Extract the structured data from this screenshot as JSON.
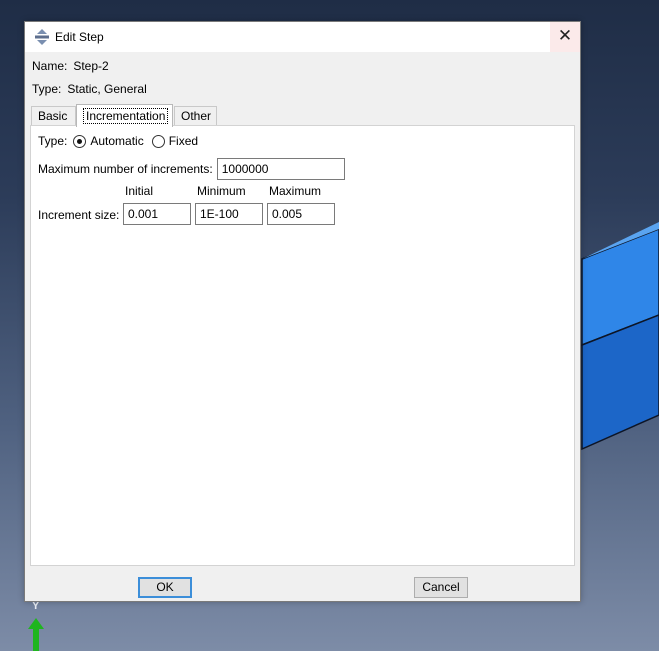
{
  "dialog": {
    "title": "Edit Step",
    "close_label": "✕",
    "name_label": "Name:",
    "name_value": "Step-2",
    "type_label": "Type:",
    "type_value": "Static, General"
  },
  "tabs": [
    {
      "label": "Basic",
      "active": false
    },
    {
      "label": "Incrementation",
      "active": true
    },
    {
      "label": "Other",
      "active": false
    }
  ],
  "incrementation": {
    "type_label": "Type:",
    "type_options": [
      {
        "label": "Automatic",
        "selected": true
      },
      {
        "label": "Fixed",
        "selected": false
      }
    ],
    "max_increments_label": "Maximum number of increments:",
    "max_increments_value": "1000000",
    "column_headers": [
      "Initial",
      "Minimum",
      "Maximum"
    ],
    "increment_size_label": "Increment size:",
    "increment_initial": "0.001",
    "increment_minimum": "1E-100",
    "increment_maximum": "0.005"
  },
  "buttons": {
    "ok_label": "OK",
    "cancel_label": "Cancel"
  },
  "viewport": {
    "triad_axis_label": "Y",
    "part_color": "#1f6fd6",
    "triad_color": "#1fb51f"
  }
}
